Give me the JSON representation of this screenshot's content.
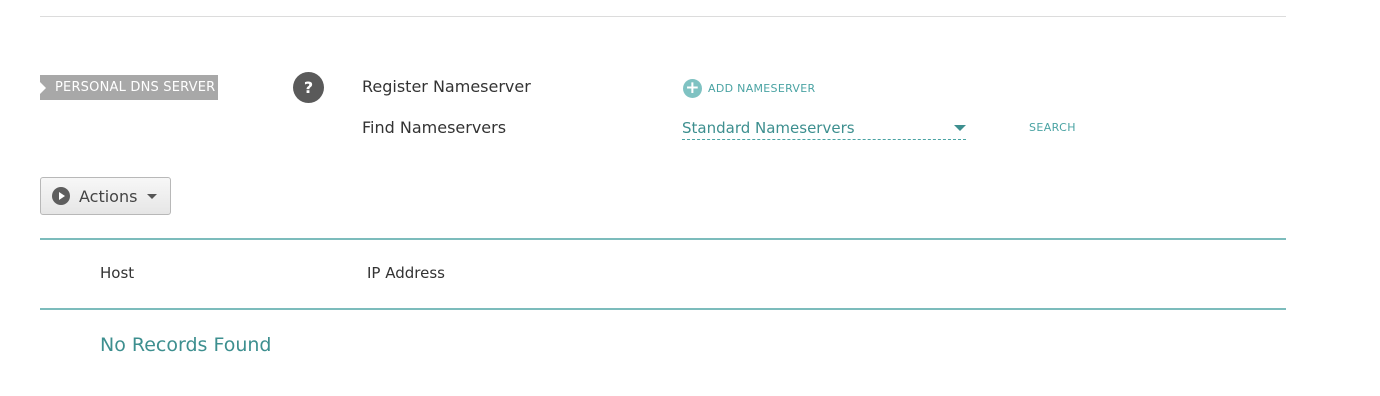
{
  "section": {
    "tag_label": "PERSONAL DNS SERVER",
    "help_icon": "question-mark-icon"
  },
  "register": {
    "label": "Register Nameserver",
    "add_label": "ADD NAMESERVER",
    "add_icon": "plus-circle-icon"
  },
  "find": {
    "label": "Find Nameservers",
    "select_value": "Standard Nameservers",
    "search_label": "SEARCH"
  },
  "toolbar": {
    "actions_label": "Actions",
    "actions_icon": "play-circle-icon"
  },
  "table": {
    "columns": [
      "Host",
      "IP Address"
    ],
    "empty_message": "No Records Found"
  },
  "colors": {
    "accent": "#4aa3a3",
    "tag_background": "#a8a8a8",
    "divider": "#7cbcbc"
  }
}
